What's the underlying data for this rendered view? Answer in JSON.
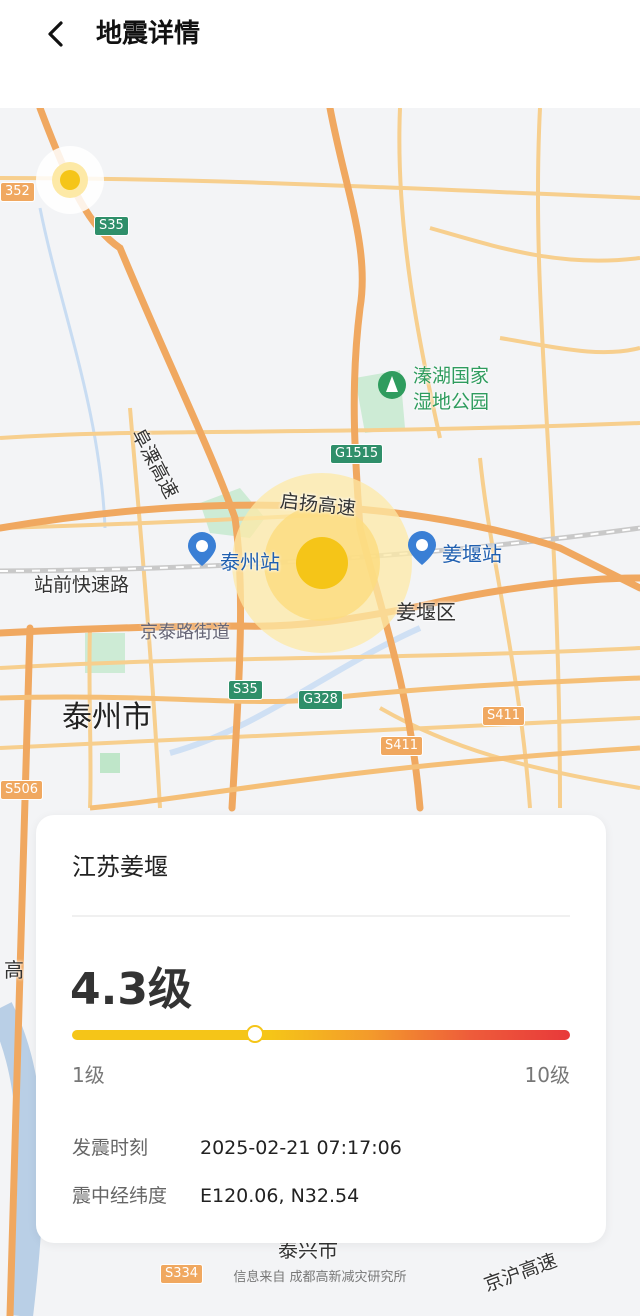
{
  "header": {
    "title": "地震详情",
    "back_icon": "chevron-left-icon"
  },
  "map": {
    "labels": {
      "park_line1": "溱湖国家",
      "park_line2": "湿地公园",
      "highway_fuli": "阜溧高速",
      "highway_qiyang": "启扬高速",
      "station_taizhou": "泰州站",
      "station_jiangyan": "姜堰站",
      "road_zhanqian": "站前快速路",
      "district_jiangyan": "姜堰区",
      "street_jingtai": "京泰路街道",
      "city_taizhou": "泰州市",
      "edge_gao": "高",
      "edge_jinghu": "京沪高速",
      "edge_taixing": "泰兴市"
    },
    "shields": {
      "s352": "352",
      "s35_top": "S35",
      "g1515": "G1515",
      "s35_mid": "S35",
      "g328": "G328",
      "s411_right": "S411",
      "s411_bottom": "S411",
      "s506": "S506",
      "s334": "S334"
    },
    "colors": {
      "epicenter": "#f5c518",
      "road": "#f5b868",
      "expressway": "#f0a060"
    },
    "credit": "信息来自 成都高新减灾研究所"
  },
  "card": {
    "location": "江苏姜堰",
    "magnitude": "4.3级",
    "magnitude_value": 4.3,
    "scale": {
      "min_label": "1级",
      "max_label": "10级",
      "min": 1,
      "max": 10
    },
    "time_label": "发震时刻",
    "time_value": "2025-02-21 07:17:06",
    "coord_label": "震中经纬度",
    "coord_value": "E120.06, N32.54"
  }
}
